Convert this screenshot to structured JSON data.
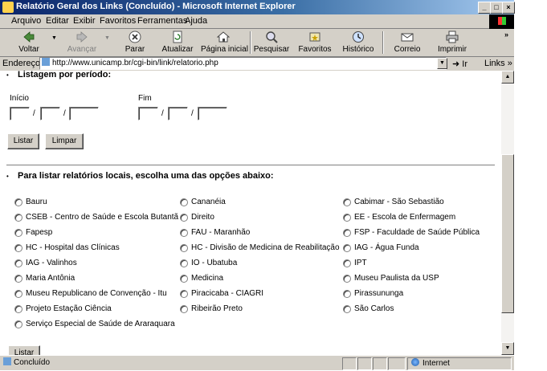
{
  "window": {
    "title": "Relatório Geral dos Links (Concluído) - Microsoft Internet Explorer",
    "controls": [
      "_",
      "□",
      "×"
    ]
  },
  "menu": [
    "Arquivo",
    "Editar",
    "Exibir",
    "Favoritos",
    "Ferramentas",
    "Ajuda"
  ],
  "toolbar": {
    "voltar": "Voltar",
    "avancar": "Avançar",
    "parar": "Parar",
    "atualizar": "Atualizar",
    "pagina_inicial": "Página inicial",
    "pesquisar": "Pesquisar",
    "favoritos": "Favoritos",
    "historico": "Histórico",
    "correio": "Correio",
    "imprimir": "Imprimir"
  },
  "address": {
    "label": "Endereço",
    "url": "http://www.unicamp.br/cgi-bin/link/relatorio.php",
    "go": "Ir",
    "links": "Links"
  },
  "periodo": {
    "title": "Listagem por período:",
    "inicio_label": "Início",
    "fim_label": "Fim",
    "sep": "/",
    "listar_button": "Listar",
    "limpar_button": "Limpar"
  },
  "locais": {
    "title": "Para listar relatórios locais, escolha uma das opções abaixo:",
    "options": [
      "Bauru",
      "Cananéia",
      "Cabimar - São Sebastião",
      "CSEB - Centro de Saúde e Escola Butantã",
      "Direito",
      "EE - Escola de Enfermagem",
      "Fapesp",
      "FAU - Maranhão",
      "FSP - Faculdade de Saúde Pública",
      "HC - Hospital das Clínicas",
      "HC - Divisão de Medicina de Reabilitação",
      "IAG - Água Funda",
      "IAG - Valinhos",
      "IO - Ubatuba",
      "IPT",
      "Maria Antônia",
      "Medicina",
      "Museu Paulista da USP",
      "Museu Republicano de Convenção - Itu",
      "Piracicaba - CIAGRI",
      "Pirassununga",
      "Projeto Estação Ciência",
      "Ribeirão Preto",
      "São Carlos",
      "Serviço Especial de Saúde de Araraquara"
    ],
    "listar_button": "Listar"
  },
  "status": {
    "text": "Concluído",
    "zone": "Internet"
  }
}
